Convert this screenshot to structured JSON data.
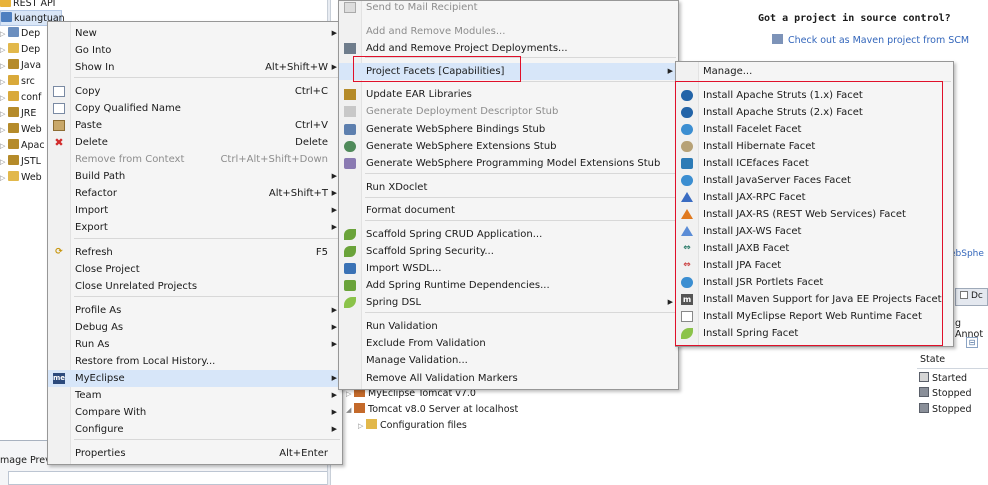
{
  "tree": {
    "rows": [
      {
        "label": "REST API",
        "tri": ""
      },
      {
        "label": "kuangtuan",
        "tri": ""
      },
      {
        "label": "Dep",
        "tri": "▷"
      },
      {
        "label": "Dep",
        "tri": "▷"
      },
      {
        "label": "Java",
        "tri": "▷"
      },
      {
        "label": "src",
        "tri": "▷"
      },
      {
        "label": "conf",
        "tri": "▷"
      },
      {
        "label": "JRE",
        "tri": "▷"
      },
      {
        "label": "Web",
        "tri": "▷"
      },
      {
        "label": "Apac",
        "tri": "▷"
      },
      {
        "label": "JSTL",
        "tri": "▷"
      },
      {
        "label": "Web",
        "tri": "▷"
      }
    ]
  },
  "bottom_panel": {
    "tab": "mage Previ"
  },
  "welcome": {
    "title": "Got a project in source control?",
    "link": "Check out as Maven project from SCM",
    "partial": "ebSphe"
  },
  "right_tabs": {
    "label": "Dc",
    "annotations": "g Annot",
    "mini": "⊟"
  },
  "servers": {
    "state_header": "State",
    "rows": [
      {
        "label": "MyEclipse Tomcat v7.0",
        "state": "Started",
        "icon": "tomcat-icon"
      },
      {
        "label": "Tomcat v8.0 Server at localhost",
        "state": "Stopped",
        "icon": "tomcat-icon"
      },
      {
        "label": "Configuration files",
        "state": "Stopped",
        "icon": "folder-icon"
      }
    ]
  },
  "context_menu": {
    "items": [
      {
        "label": "New",
        "shortcut": "",
        "submenu": true,
        "icon": ""
      },
      {
        "label": "Go Into",
        "shortcut": "",
        "submenu": false,
        "icon": ""
      },
      {
        "label": "Show In",
        "shortcut": "Alt+Shift+W",
        "submenu": true,
        "icon": ""
      },
      {
        "label": "Copy",
        "shortcut": "Ctrl+C",
        "submenu": false,
        "icon": "copy-icon"
      },
      {
        "label": "Copy Qualified Name",
        "shortcut": "",
        "submenu": false,
        "icon": "copy-qualified-icon"
      },
      {
        "label": "Paste",
        "shortcut": "Ctrl+V",
        "submenu": false,
        "icon": "paste-icon"
      },
      {
        "label": "Delete",
        "shortcut": "Delete",
        "submenu": false,
        "icon": "delete-icon"
      },
      {
        "label": "Remove from Context",
        "shortcut": "Ctrl+Alt+Shift+Down",
        "submenu": false,
        "icon": "remove-context-icon",
        "disabled": true
      },
      {
        "label": "Build Path",
        "shortcut": "",
        "submenu": true,
        "icon": ""
      },
      {
        "label": "Refactor",
        "shortcut": "Alt+Shift+T",
        "submenu": true,
        "icon": ""
      },
      {
        "label": "Import",
        "shortcut": "",
        "submenu": true,
        "icon": ""
      },
      {
        "label": "Export",
        "shortcut": "",
        "submenu": true,
        "icon": ""
      },
      {
        "label": "Refresh",
        "shortcut": "F5",
        "submenu": false,
        "icon": "refresh-icon"
      },
      {
        "label": "Close Project",
        "shortcut": "",
        "submenu": false,
        "icon": ""
      },
      {
        "label": "Close Unrelated Projects",
        "shortcut": "",
        "submenu": false,
        "icon": ""
      },
      {
        "label": "Profile As",
        "shortcut": "",
        "submenu": true,
        "icon": ""
      },
      {
        "label": "Debug As",
        "shortcut": "",
        "submenu": true,
        "icon": ""
      },
      {
        "label": "Run As",
        "shortcut": "",
        "submenu": true,
        "icon": ""
      },
      {
        "label": "Restore from Local History...",
        "shortcut": "",
        "submenu": false,
        "icon": ""
      },
      {
        "label": "MyEclipse",
        "shortcut": "",
        "submenu": true,
        "icon": "myeclipse-icon",
        "highlight": true
      },
      {
        "label": "Team",
        "shortcut": "",
        "submenu": true,
        "icon": ""
      },
      {
        "label": "Compare With",
        "shortcut": "",
        "submenu": true,
        "icon": ""
      },
      {
        "label": "Configure",
        "shortcut": "",
        "submenu": true,
        "icon": ""
      },
      {
        "label": "Properties",
        "shortcut": "Alt+Enter",
        "submenu": false,
        "icon": ""
      }
    ],
    "myeclipse_badge": "me"
  },
  "myeclipse_menu": {
    "items": [
      {
        "label": "Send to Mail Recipient",
        "submenu": false,
        "icon": "mail-icon",
        "disabled": true
      },
      {
        "label": "Add and Remove Modules...",
        "submenu": false,
        "icon": "",
        "disabled": true
      },
      {
        "label": "Add and Remove Project Deployments...",
        "submenu": false,
        "icon": "deploy-icon"
      },
      {
        "label": "Project Facets [Capabilities]",
        "submenu": true,
        "icon": "",
        "highlight": true
      },
      {
        "label": "Update EAR Libraries",
        "submenu": false,
        "icon": "library-icon"
      },
      {
        "label": "Generate Deployment Descriptor Stub",
        "submenu": false,
        "icon": "descriptor-icon",
        "disabled": true
      },
      {
        "label": "Generate WebSphere Bindings Stub",
        "submenu": false,
        "icon": "bindings-icon"
      },
      {
        "label": "Generate WebSphere Extensions Stub",
        "submenu": false,
        "icon": "extensions-icon"
      },
      {
        "label": "Generate WebSphere Programming Model Extensions Stub",
        "submenu": false,
        "icon": "pme-icon"
      },
      {
        "label": "Run XDoclet",
        "submenu": false,
        "icon": ""
      },
      {
        "label": "Format document",
        "submenu": false,
        "icon": ""
      },
      {
        "label": "Scaffold Spring CRUD Application...",
        "submenu": false,
        "icon": "spring-icon"
      },
      {
        "label": "Scaffold Spring Security...",
        "submenu": false,
        "icon": "spring-icon"
      },
      {
        "label": "Import WSDL...",
        "submenu": false,
        "icon": "wsdl-icon"
      },
      {
        "label": "Add Spring Runtime Dependencies...",
        "submenu": false,
        "icon": "spring-add-icon"
      },
      {
        "label": "Spring DSL",
        "submenu": true,
        "icon": "spring-leaf-icon"
      },
      {
        "label": "Run Validation",
        "submenu": false,
        "icon": ""
      },
      {
        "label": "Exclude From Validation",
        "submenu": false,
        "icon": ""
      },
      {
        "label": "Manage Validation...",
        "submenu": false,
        "icon": ""
      },
      {
        "label": "Remove All Validation Markers",
        "submenu": false,
        "icon": ""
      }
    ]
  },
  "facets_menu": {
    "items": [
      {
        "label": "Manage...",
        "icon": ""
      },
      {
        "label": "Install Apache Struts (1.x) Facet",
        "icon": "struts-icon"
      },
      {
        "label": "Install Apache Struts (2.x) Facet",
        "icon": "struts-icon"
      },
      {
        "label": "Install Facelet Facet",
        "icon": "facelet-icon"
      },
      {
        "label": "Install Hibernate Facet",
        "icon": "hibernate-icon"
      },
      {
        "label": "Install ICEfaces Facet",
        "icon": "icefaces-icon"
      },
      {
        "label": "Install JavaServer Faces Facet",
        "icon": "jsf-icon"
      },
      {
        "label": "Install JAX-RPC Facet",
        "icon": "jaxrpc-icon"
      },
      {
        "label": "Install JAX-RS (REST Web Services) Facet",
        "icon": "jaxrs-icon"
      },
      {
        "label": "Install JAX-WS Facet",
        "icon": "jaxws-icon"
      },
      {
        "label": "Install JAXB Facet",
        "icon": "jaxb-icon"
      },
      {
        "label": "Install JPA Facet",
        "icon": "jpa-icon"
      },
      {
        "label": "Install JSR Portlets Facet",
        "icon": "portlet-icon"
      },
      {
        "label": "Install Maven Support for Java EE Projects Facet",
        "icon": "maven-icon"
      },
      {
        "label": "Install MyEclipse Report Web Runtime Facet",
        "icon": "report-icon"
      },
      {
        "label": "Install Spring Facet",
        "icon": "spring-leaf-icon"
      }
    ],
    "maven_badge": "m"
  }
}
